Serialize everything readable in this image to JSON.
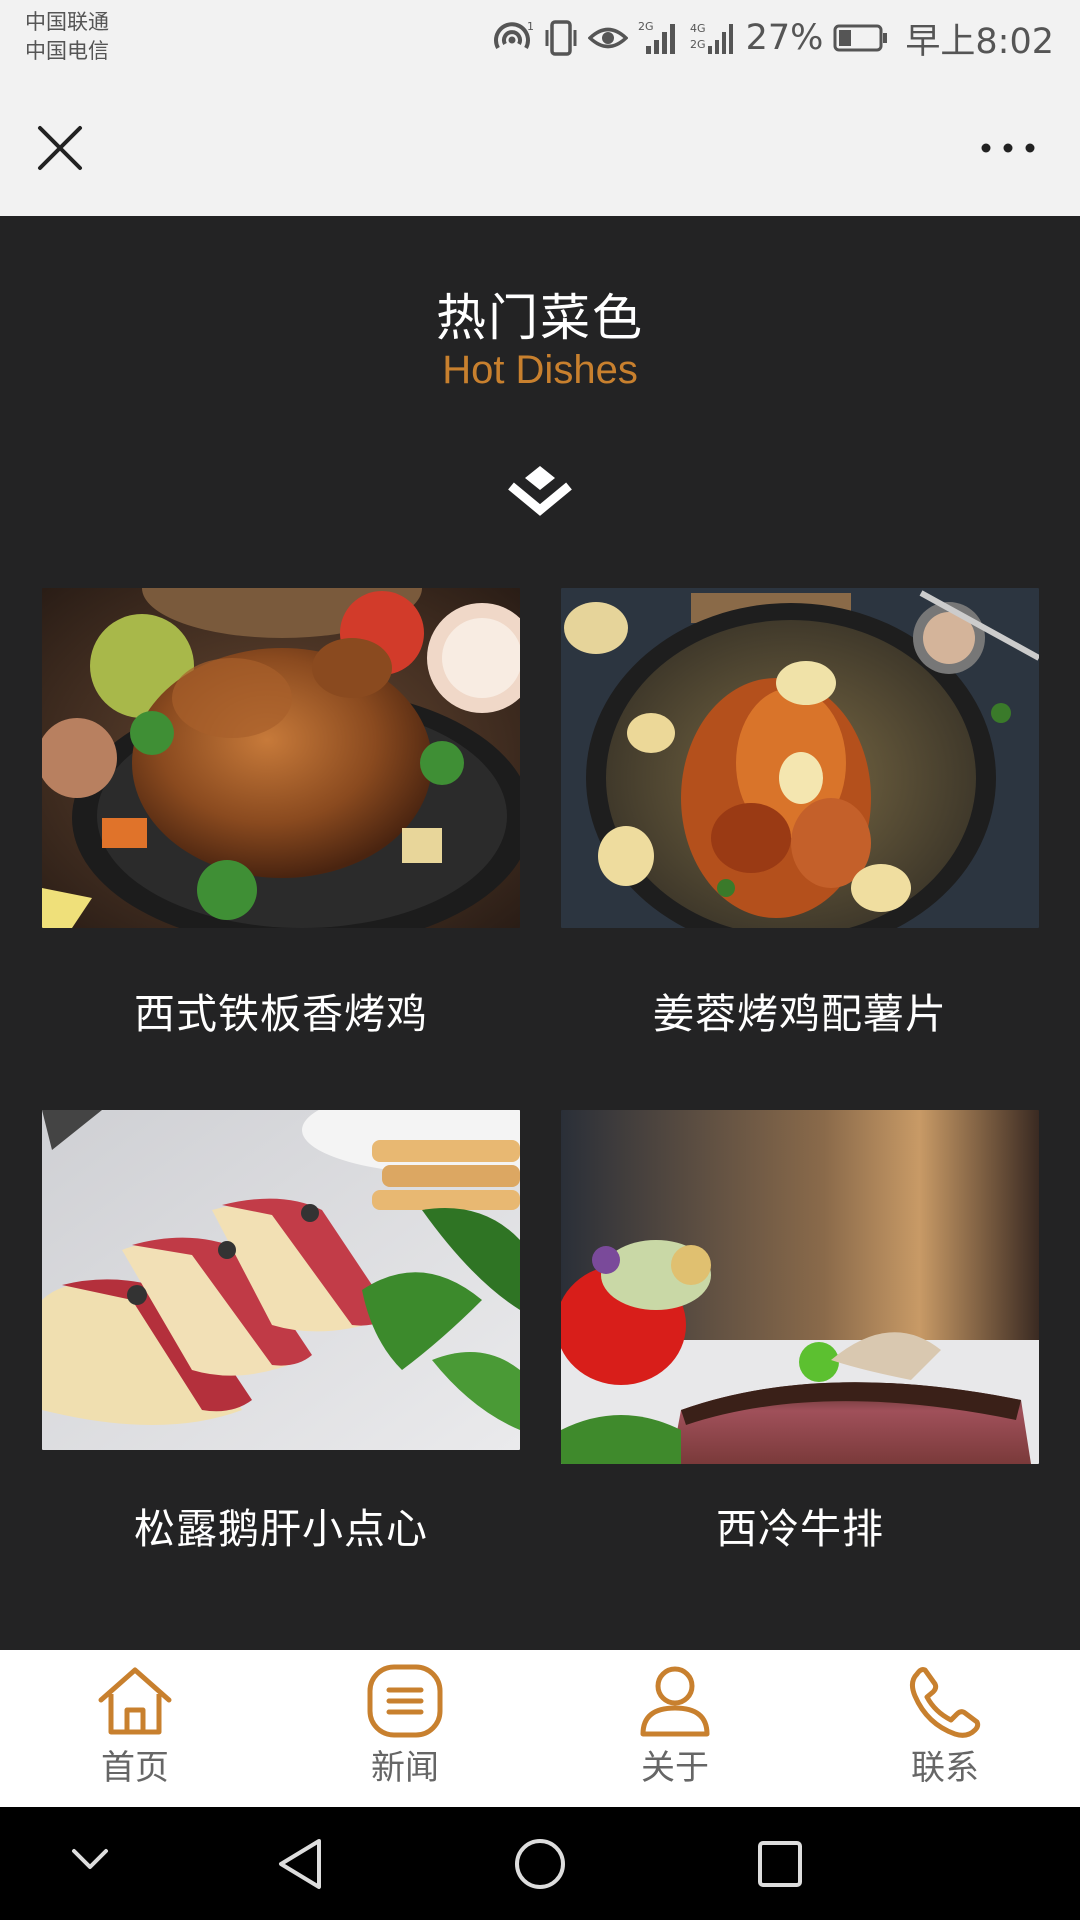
{
  "status_bar": {
    "carrier1": "中国联通",
    "carrier2": "中国电信",
    "battery": "27%",
    "time": "早上8:02"
  },
  "header": {
    "title_zh": "热门菜色",
    "title_en": "Hot Dishes"
  },
  "dishes": [
    {
      "name": "西式铁板香烤鸡"
    },
    {
      "name": "姜蓉烤鸡配薯片"
    },
    {
      "name": "松露鹅肝小点心"
    },
    {
      "name": "西冷牛排"
    }
  ],
  "tabs": [
    {
      "label": "首页",
      "icon": "home-icon"
    },
    {
      "label": "新闻",
      "icon": "news-icon"
    },
    {
      "label": "关于",
      "icon": "user-icon"
    },
    {
      "label": "联系",
      "icon": "phone-icon"
    }
  ],
  "colors": {
    "accent": "#c8802e",
    "background": "#232324",
    "header_bg": "#f2f2f2"
  }
}
